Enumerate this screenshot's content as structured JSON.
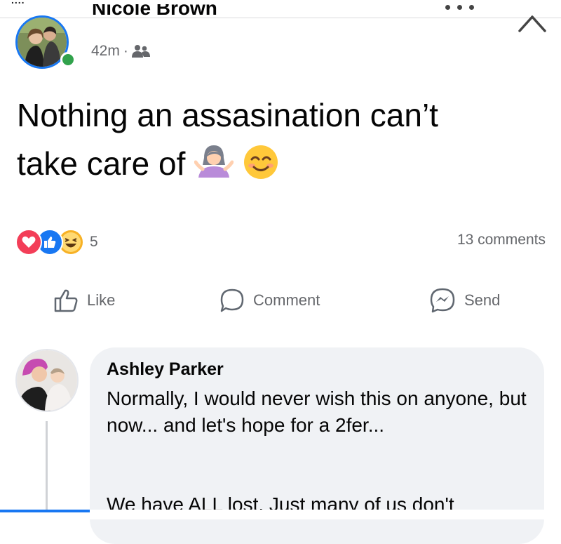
{
  "header": {
    "top_strip_text": "....",
    "author_name": "Nicole Brown",
    "timestamp": "42m",
    "separator": "·",
    "audience_icon": "friends-icon",
    "more_icon": "more-dots-icon",
    "close_icon": "close-icon"
  },
  "post": {
    "line1": "Nothing an assasination can’t",
    "line2": "take care of",
    "emojis": [
      "woman-shrugging-emoji",
      "smiling-face-emoji"
    ]
  },
  "stats": {
    "reaction_icons": [
      "love-reaction-icon",
      "like-reaction-icon",
      "haha-reaction-icon"
    ],
    "reaction_count": "5",
    "comments_count": "13 comments"
  },
  "actions": {
    "like": "Like",
    "comment": "Comment",
    "send": "Send"
  },
  "comment": {
    "author": "Ashley Parker",
    "text": "Normally, I would never wish this on anyone, but now... and let's hope for a 2fer...",
    "text2": "We have ALL lost. Just many of us don't"
  },
  "colors": {
    "accent": "#1877f2",
    "online": "#31a24c",
    "muted_text": "#65676b",
    "bubble": "#f0f2f5"
  }
}
